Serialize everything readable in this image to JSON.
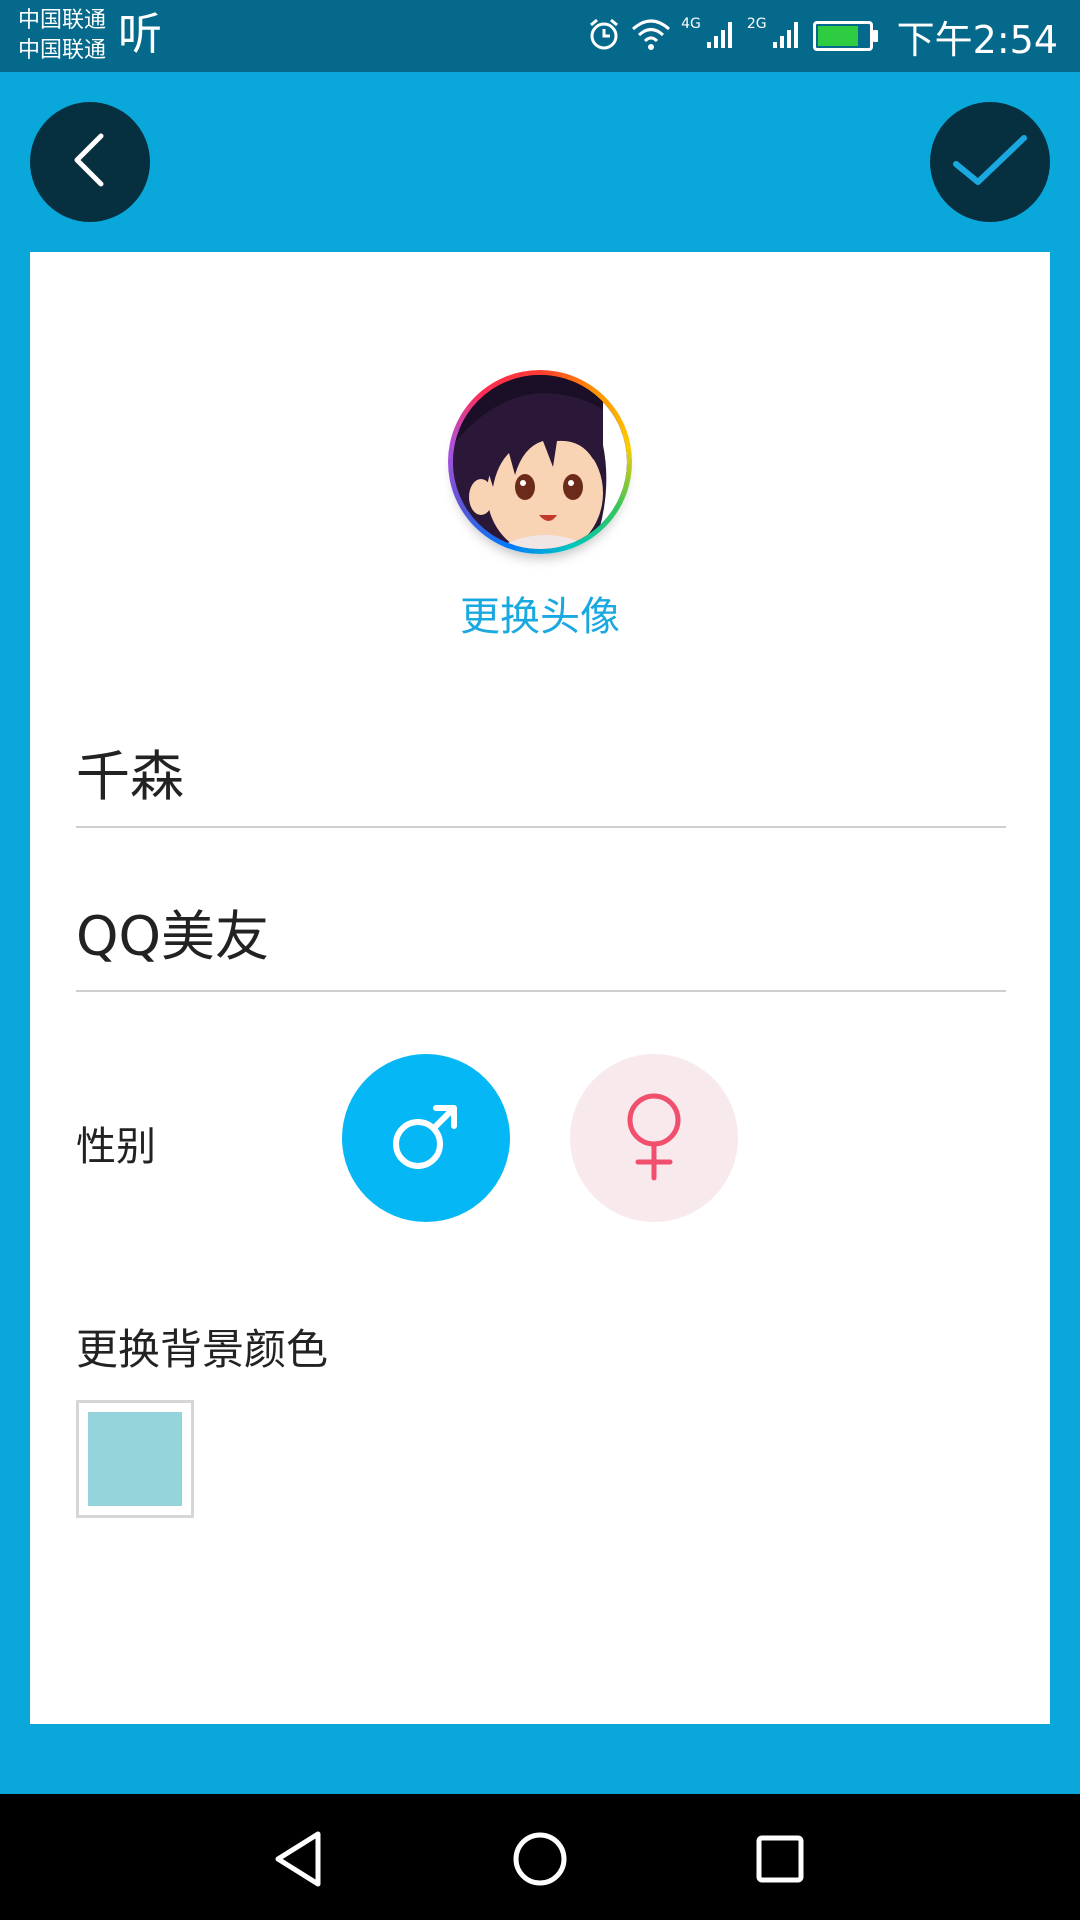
{
  "status_bar": {
    "carrier_line1": "中国联通",
    "carrier_line2": "中国联通",
    "listen_icon_text": "听",
    "signal1_label": "4G",
    "signal2_label": "2G",
    "time": "下午2:54"
  },
  "top_bar": {
    "back_icon": "chevron-left-icon",
    "confirm_icon": "check-icon"
  },
  "profile": {
    "change_avatar_label": "更换头像",
    "name_value": "千森",
    "signature_value": "QQ美友",
    "gender_label": "性别",
    "gender_options": [
      "male",
      "female"
    ],
    "selected_gender": "male",
    "change_bg_label": "更换背景颜色",
    "bg_color": "#96d4dc"
  },
  "colors": {
    "accent": "#0aa8da",
    "status_bar": "#05698c",
    "male": "#06b7f5",
    "female_bg": "#f7e9ec",
    "female_symbol": "#f0506e"
  },
  "nav_bar": {
    "buttons": [
      "back-triangle-icon",
      "home-circle-icon",
      "recents-square-icon"
    ]
  }
}
